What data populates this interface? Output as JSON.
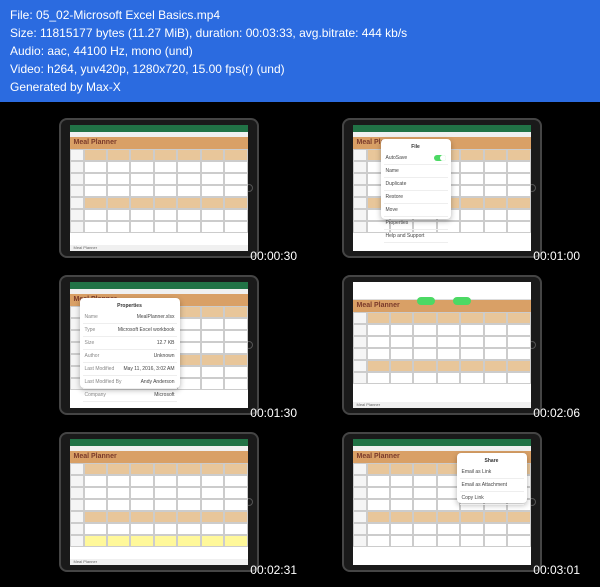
{
  "header": {
    "file_label": "File:",
    "file_value": "05_02-Microsoft Excel Basics.mp4",
    "size_label": "Size:",
    "size_value": "11815177 bytes (11.27 MiB), duration: 00:03:33, avg.bitrate: 444 kb/s",
    "audio_label": "Audio:",
    "audio_value": "aac, 44100 Hz, mono (und)",
    "video_label": "Video:",
    "video_value": "h264, yuv420p, 1280x720, 15.00 fps(r) (und)",
    "generated": "Generated by Max-X"
  },
  "planner_title": "Meal Planner",
  "tab_label": "Meal Planner",
  "thumbs": [
    {
      "timecode": "00:00:30"
    },
    {
      "timecode": "00:01:00"
    },
    {
      "timecode": "00:01:30"
    },
    {
      "timecode": "00:02:06"
    },
    {
      "timecode": "00:02:31"
    },
    {
      "timecode": "00:03:01"
    }
  ],
  "file_menu": {
    "title": "File",
    "items": [
      "AutoSave",
      "Name",
      "Duplicate",
      "Restore",
      "Move",
      "Properties",
      "Help and Support"
    ]
  },
  "properties": {
    "title": "Properties",
    "items": [
      {
        "k": "Name",
        "v": "MealPlanner.xlsx"
      },
      {
        "k": "Type",
        "v": "Microsoft Excel workbook"
      },
      {
        "k": "Size",
        "v": "12.7 KB"
      },
      {
        "k": "Author",
        "v": "Unknown"
      },
      {
        "k": "Last Modified",
        "v": "May 11, 2016, 3:02 AM"
      },
      {
        "k": "Last Modified By",
        "v": "Andy Anderson"
      },
      {
        "k": "Company",
        "v": "Microsoft"
      }
    ]
  },
  "share_menu": {
    "title": "Share",
    "items": [
      "Email as Link",
      "Email as Attachment",
      "Copy Link"
    ]
  }
}
